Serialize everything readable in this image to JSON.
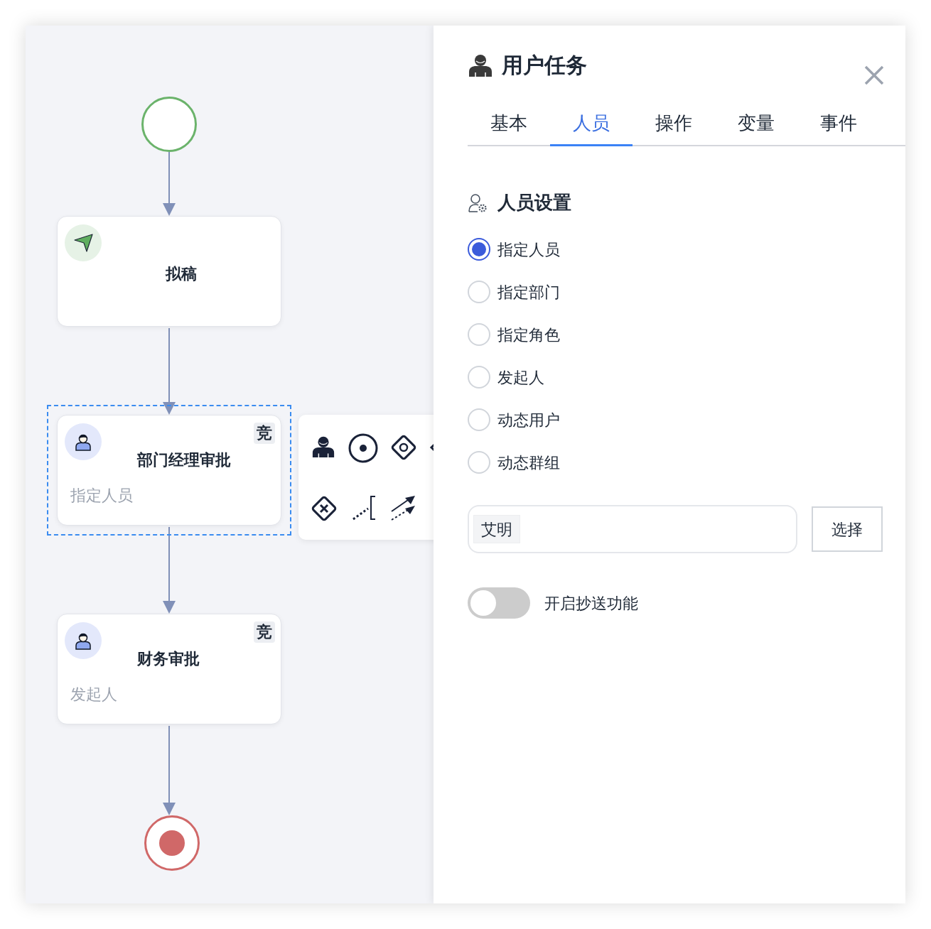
{
  "nodes": [
    {
      "kind": "draft",
      "label": "拟稿",
      "selected": false
    },
    {
      "kind": "user",
      "label": "部门经理审批",
      "badge": "竞",
      "subtitle": "指定人员",
      "selected": true
    },
    {
      "kind": "user",
      "label": "财务审批",
      "badge": "竞",
      "subtitle": "发起人",
      "selected": false
    }
  ],
  "panel": {
    "title": "用户任务",
    "tabs": [
      {
        "label": "基本",
        "selected": false
      },
      {
        "label": "人员",
        "selected": true
      },
      {
        "label": "操作",
        "selected": false
      },
      {
        "label": "变量",
        "selected": false
      },
      {
        "label": "事件",
        "selected": false
      }
    ],
    "section_title": "人员设置",
    "options": [
      {
        "label": "指定人员",
        "selected": true
      },
      {
        "label": "指定部门",
        "selected": false
      },
      {
        "label": "指定角色",
        "selected": false
      },
      {
        "label": "发起人",
        "selected": false
      },
      {
        "label": "动态用户",
        "selected": false
      },
      {
        "label": "动态群组",
        "selected": false
      }
    ],
    "assignees": [
      "艾明"
    ],
    "select_button": "选择",
    "cc_toggle": {
      "label": "开启抄送功能",
      "on": false
    }
  }
}
